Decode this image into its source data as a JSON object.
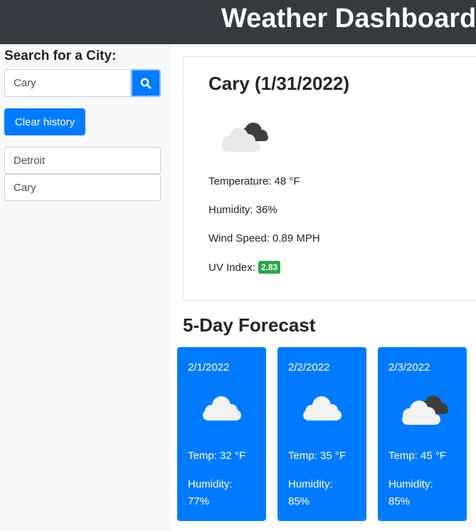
{
  "header": {
    "title": "Weather Dashboard"
  },
  "sidebar": {
    "search_label": "Search for a City:",
    "search_value": "Cary",
    "search_icon": "search-icon",
    "clear_label": "Clear history",
    "history": [
      {
        "city": "Detroit"
      },
      {
        "city": "Cary"
      }
    ]
  },
  "current": {
    "title": "Cary (1/31/2022)",
    "icon": "broken-clouds-icon",
    "temperature": "Temperature: 48 °F",
    "humidity": "Humidity: 36%",
    "wind": "Wind Speed: 0.89 MPH",
    "uv_label": "UV Index:",
    "uv_value": "2.83",
    "uv_color": "#28a745"
  },
  "forecast": {
    "heading": "5-Day Forecast",
    "days": [
      {
        "date": "2/1/2022",
        "icon": "cloud-icon",
        "temp": "Temp: 32 °F",
        "humidity_label": "Humidity:",
        "humidity_value": "77%"
      },
      {
        "date": "2/2/2022",
        "icon": "cloud-icon",
        "temp": "Temp: 35 °F",
        "humidity_label": "Humidity:",
        "humidity_value": "85%"
      },
      {
        "date": "2/3/2022",
        "icon": "broken-clouds-icon",
        "temp": "Temp: 45 °F",
        "humidity_label": "Humidity:",
        "humidity_value": "85%"
      }
    ]
  },
  "colors": {
    "navbar": "#343a40",
    "primary": "#007bff",
    "sidebar_bg": "#f8f9fa",
    "success": "#28a745"
  }
}
